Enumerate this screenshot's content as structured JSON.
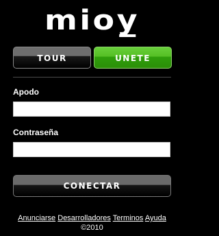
{
  "logo": {
    "text": "mioy"
  },
  "nav": {
    "tour_label": "TOUR",
    "unete_label": "UNETE"
  },
  "form": {
    "apodo_label": "Apodo",
    "apodo_value": "",
    "password_label": "Contraseña",
    "password_value": "",
    "submit_label": "CONECTAR"
  },
  "footer": {
    "links": [
      "Anunciarse",
      "Desarrolladores",
      "Terminos",
      "Ayuda"
    ],
    "copyright": "©2010"
  },
  "colors": {
    "background": "#000000",
    "accent_green": "#55bf24",
    "button_gray": "#6e6e6e",
    "text": "#ffffff"
  }
}
